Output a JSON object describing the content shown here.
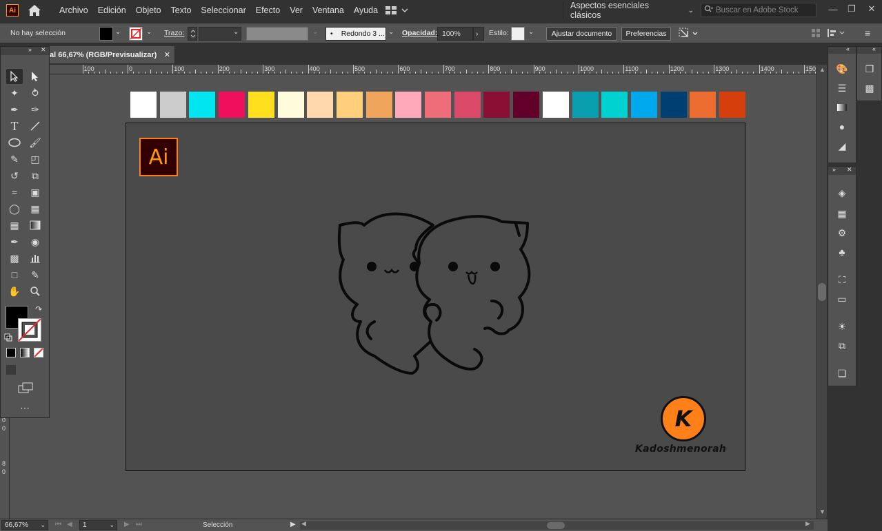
{
  "app": {
    "logo_text": "Ai",
    "menus": [
      "Archivo",
      "Edición",
      "Objeto",
      "Texto",
      "Seleccionar",
      "Efecto",
      "Ver",
      "Ventana",
      "Ayuda"
    ],
    "workspace": "Aspectos esenciales clásicos",
    "stock_search_placeholder": "Buscar en Adobe Stock"
  },
  "control_bar": {
    "selection_status": "No hay selección",
    "stroke_label": "Trazo:",
    "brush_label": "Redondo 3 ...",
    "opacity_label": "Opacidad:",
    "opacity_value": "100%",
    "style_label": "Estilo:",
    "fit_document_button": "Ajustar documento",
    "preferences_button": "Preferencias"
  },
  "document": {
    "tab_title": "al 66,67% (RGB/Previsualizar)",
    "artboard_logo_text": "Ai",
    "watermark_letter": "K",
    "watermark_name": "Kadoshmenorah"
  },
  "ruler": {
    "ticks": [
      "100",
      "0",
      "100",
      "200",
      "300",
      "400",
      "500",
      "600",
      "700",
      "800",
      "900",
      "1000",
      "1100",
      "1200",
      "1300",
      "1400",
      "150"
    ],
    "left_ticks": [
      "0",
      "0",
      "8",
      "0"
    ]
  },
  "swatches": [
    "#ffffff",
    "#cccccc",
    "#00e5ee",
    "#ef0f5d",
    "#ffdf1e",
    "#fffcdc",
    "#ffd9ad",
    "#ffcf7b",
    "#f0a55c",
    "#ffa9bb",
    "#ef6d79",
    "#db4b69",
    "#8b0f34",
    "#62002a",
    "#ffffff",
    "#0a9fae",
    "#00d2d2",
    "#00a9ed",
    "#003f72",
    "#ed6d31",
    "#d63e0b"
  ],
  "status_bar": {
    "zoom": "66,67%",
    "artboard_number": "1",
    "tool_name": "Selección"
  },
  "colors": {
    "accent_orange": "#ff7f18",
    "ui_dark": "#323232",
    "ui_panel": "#535353",
    "canvas": "#535353",
    "artboard": "#4a4a4a"
  }
}
